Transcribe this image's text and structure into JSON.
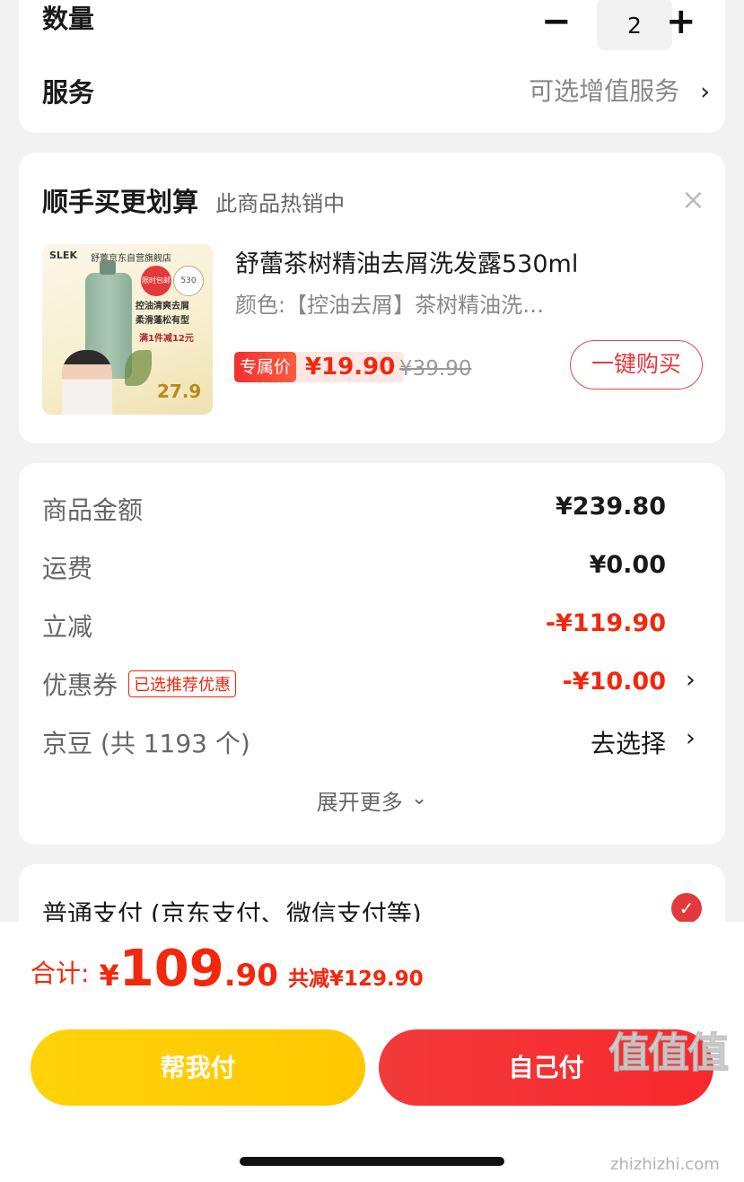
{
  "quantity": {
    "label": "数量",
    "minus": "−",
    "value": "2",
    "plus": "+"
  },
  "service": {
    "label": "服务",
    "value": "可选增值服务",
    "chevron": "›"
  },
  "recommend": {
    "title": "顺手买更划算",
    "subtitle": "此商品热销中",
    "close": "×",
    "product": {
      "name": "舒蕾茶树精油去屑洗发露530ml",
      "variant": "颜色:【控油去屑】茶树精油洗…",
      "price_tag": "专属价",
      "price": "¥19.90",
      "original_price": "¥39.90",
      "buy_button": "一键购买",
      "image": {
        "brand": "SLEK",
        "store": "舒蕾京东自营旗舰店",
        "badge": "限时包邮",
        "size": "530",
        "line1": "控油清爽去屑",
        "line2": "柔滑蓬松有型",
        "promo": "满1件减12元",
        "price": "27.9"
      }
    }
  },
  "summary": {
    "rows": [
      {
        "label": "商品金额",
        "value": "¥239.80"
      },
      {
        "label": "运费",
        "value": "¥0.00"
      },
      {
        "label": "立减",
        "value": "-¥119.90"
      },
      {
        "label": "优惠券",
        "tag": "已选推荐优惠",
        "value": "-¥10.00",
        "chevron": "›"
      },
      {
        "label": "京豆 (共 1193 个)",
        "value": "去选择",
        "chevron": "›"
      }
    ],
    "expand": "展开更多",
    "expand_icon": "⌄"
  },
  "payment": {
    "label": "普通支付 (京东支付、微信支付等)",
    "check": "✓"
  },
  "total": {
    "label": "合计:",
    "currency": "¥",
    "integer": "109",
    "decimal": ".90",
    "discount": "共减¥129.90"
  },
  "buttons": {
    "help_pay": "帮我付",
    "self_pay": "自己付"
  },
  "watermark": {
    "logo": "值值值",
    "site": "zhizhizhi.com"
  },
  "colors": {
    "accent_red": "#f2270c",
    "yellow": "#ffc800"
  }
}
